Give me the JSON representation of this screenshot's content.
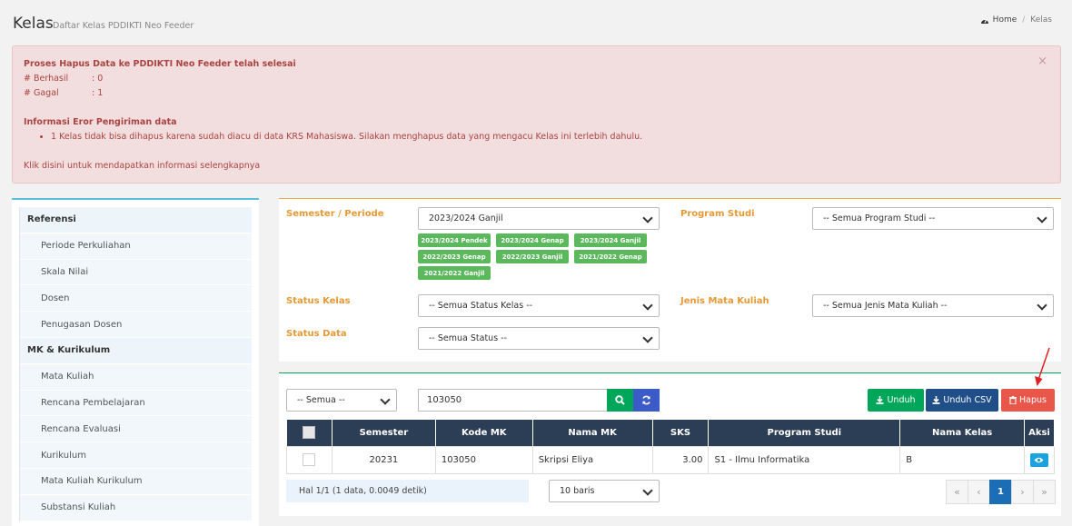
{
  "header": {
    "title": "Kelas",
    "subtitle": "Daftar Kelas PDDIKTI Neo Feeder",
    "breadcrumb": {
      "home": "Home",
      "sep": "/",
      "current": "Kelas"
    }
  },
  "alert": {
    "title": "Proses Hapus Data ke PDDIKTI Neo Feeder telah selesai",
    "berhasil_label": "# Berhasil",
    "berhasil_value": ": 0",
    "gagal_label": "# Gagal",
    "gagal_value": ": 1",
    "error_title": "Informasi Eror Pengiriman data",
    "error_item": "1 Kelas tidak bisa dihapus karena sudah diacu di data KRS Mahasiswa. Silakan menghapus data yang mengacu Kelas ini terlebih dahulu.",
    "link_prefix": "Klik ",
    "link_text": "disini",
    "link_suffix": " untuk mendapatkan informasi selengkapnya",
    "close": "×"
  },
  "sidebar": {
    "items": [
      {
        "label": "Referensi",
        "type": "head"
      },
      {
        "label": "Periode Perkuliahan",
        "type": "sub"
      },
      {
        "label": "Skala Nilai",
        "type": "sub"
      },
      {
        "label": "Dosen",
        "type": "sub"
      },
      {
        "label": "Penugasan Dosen",
        "type": "sub"
      },
      {
        "label": "MK & Kurikulum",
        "type": "head"
      },
      {
        "label": "Mata Kuliah",
        "type": "sub"
      },
      {
        "label": "Rencana Pembelajaran",
        "type": "sub"
      },
      {
        "label": "Rencana Evaluasi",
        "type": "sub"
      },
      {
        "label": "Kurikulum",
        "type": "sub"
      },
      {
        "label": "Mata Kuliah Kurikulum",
        "type": "sub"
      },
      {
        "label": "Substansi Kuliah",
        "type": "sub"
      }
    ]
  },
  "filters": {
    "semester_label": "Semester / Periode",
    "semester_value": "2023/2024 Ganjil",
    "semester_tags": [
      "2023/2024 Pendek",
      "2023/2024 Genap",
      "2023/2024 Ganjil",
      "2022/2023 Genap",
      "2022/2023 Ganjil",
      "2021/2022 Genap",
      "2021/2022 Ganjil"
    ],
    "prodi_label": "Program Studi",
    "prodi_value": "-- Semua Program Studi --",
    "status_kelas_label": "Status Kelas",
    "status_kelas_value": "-- Semua Status Kelas --",
    "jenis_mk_label": "Jenis Mata Kuliah",
    "jenis_mk_value": "-- Semua Jenis Mata Kuliah --",
    "status_data_label": "Status Data",
    "status_data_value": "-- Semua Status --"
  },
  "toolbar": {
    "field_select": "-- Semua --",
    "search_value": "103050",
    "unduh": "Unduh",
    "unduh_csv": "Unduh CSV",
    "hapus": "Hapus"
  },
  "table": {
    "headers": [
      "Semester",
      "Kode MK",
      "Nama MK",
      "SKS",
      "Program Studi",
      "Nama Kelas",
      "Aksi"
    ],
    "rows": [
      {
        "semester": "20231",
        "kode_mk": "103050",
        "nama_mk": "Skripsi Eliya",
        "sks": "3.00",
        "prodi": "S1 - Ilmu Informatika",
        "nama_kelas": "B"
      }
    ]
  },
  "footer": {
    "info": "Hal 1/1 (1 data, 0.0049 detik)",
    "per_page": "10 baris",
    "pages": [
      "«",
      "‹",
      "1",
      "›",
      "»"
    ]
  },
  "colors": {
    "accent_orange": "#e69a35",
    "green": "#5cb85c",
    "navy": "#2c3e55",
    "danger": "#e8574a"
  }
}
